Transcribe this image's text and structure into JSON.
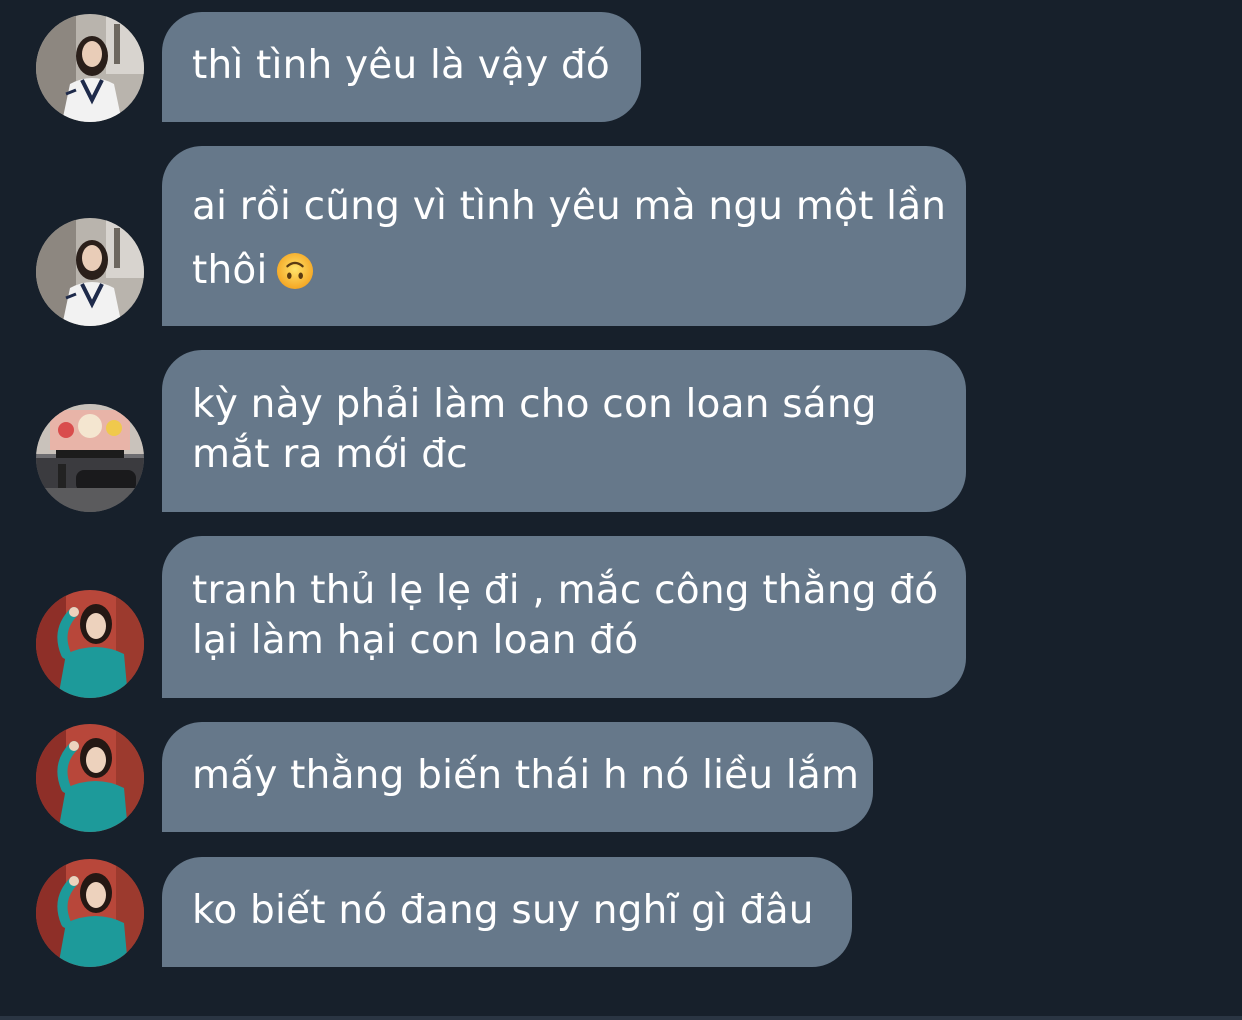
{
  "theme": {
    "background": "#17202b",
    "bubble_color": "#66788a",
    "text_color": "#ffffff"
  },
  "messages": [
    {
      "avatar": "avatar-girl-white-vest",
      "lines": [
        "thì tình yêu là vậy đó"
      ]
    },
    {
      "avatar": "avatar-girl-white-vest",
      "lines": [
        "ai rồi cũng vì tình yêu mà ngu một lần",
        "thôi"
      ],
      "emoji": "upside-down-face-emoji"
    },
    {
      "avatar": "avatar-street-storefront",
      "lines": [
        "kỳ này phải làm cho con loan sáng",
        "mắt ra mới đc"
      ]
    },
    {
      "avatar": "avatar-girl-teal-dress",
      "lines": [
        "tranh thủ lẹ lẹ đi , mắc công thằng đó",
        "lại làm hại con loan đó"
      ]
    },
    {
      "avatar": "avatar-girl-teal-dress",
      "lines": [
        "mấy thằng biến thái h nó liều lắm"
      ]
    },
    {
      "avatar": "avatar-girl-teal-dress",
      "lines": [
        "ko biết nó đang suy nghĩ gì đâu"
      ]
    }
  ]
}
